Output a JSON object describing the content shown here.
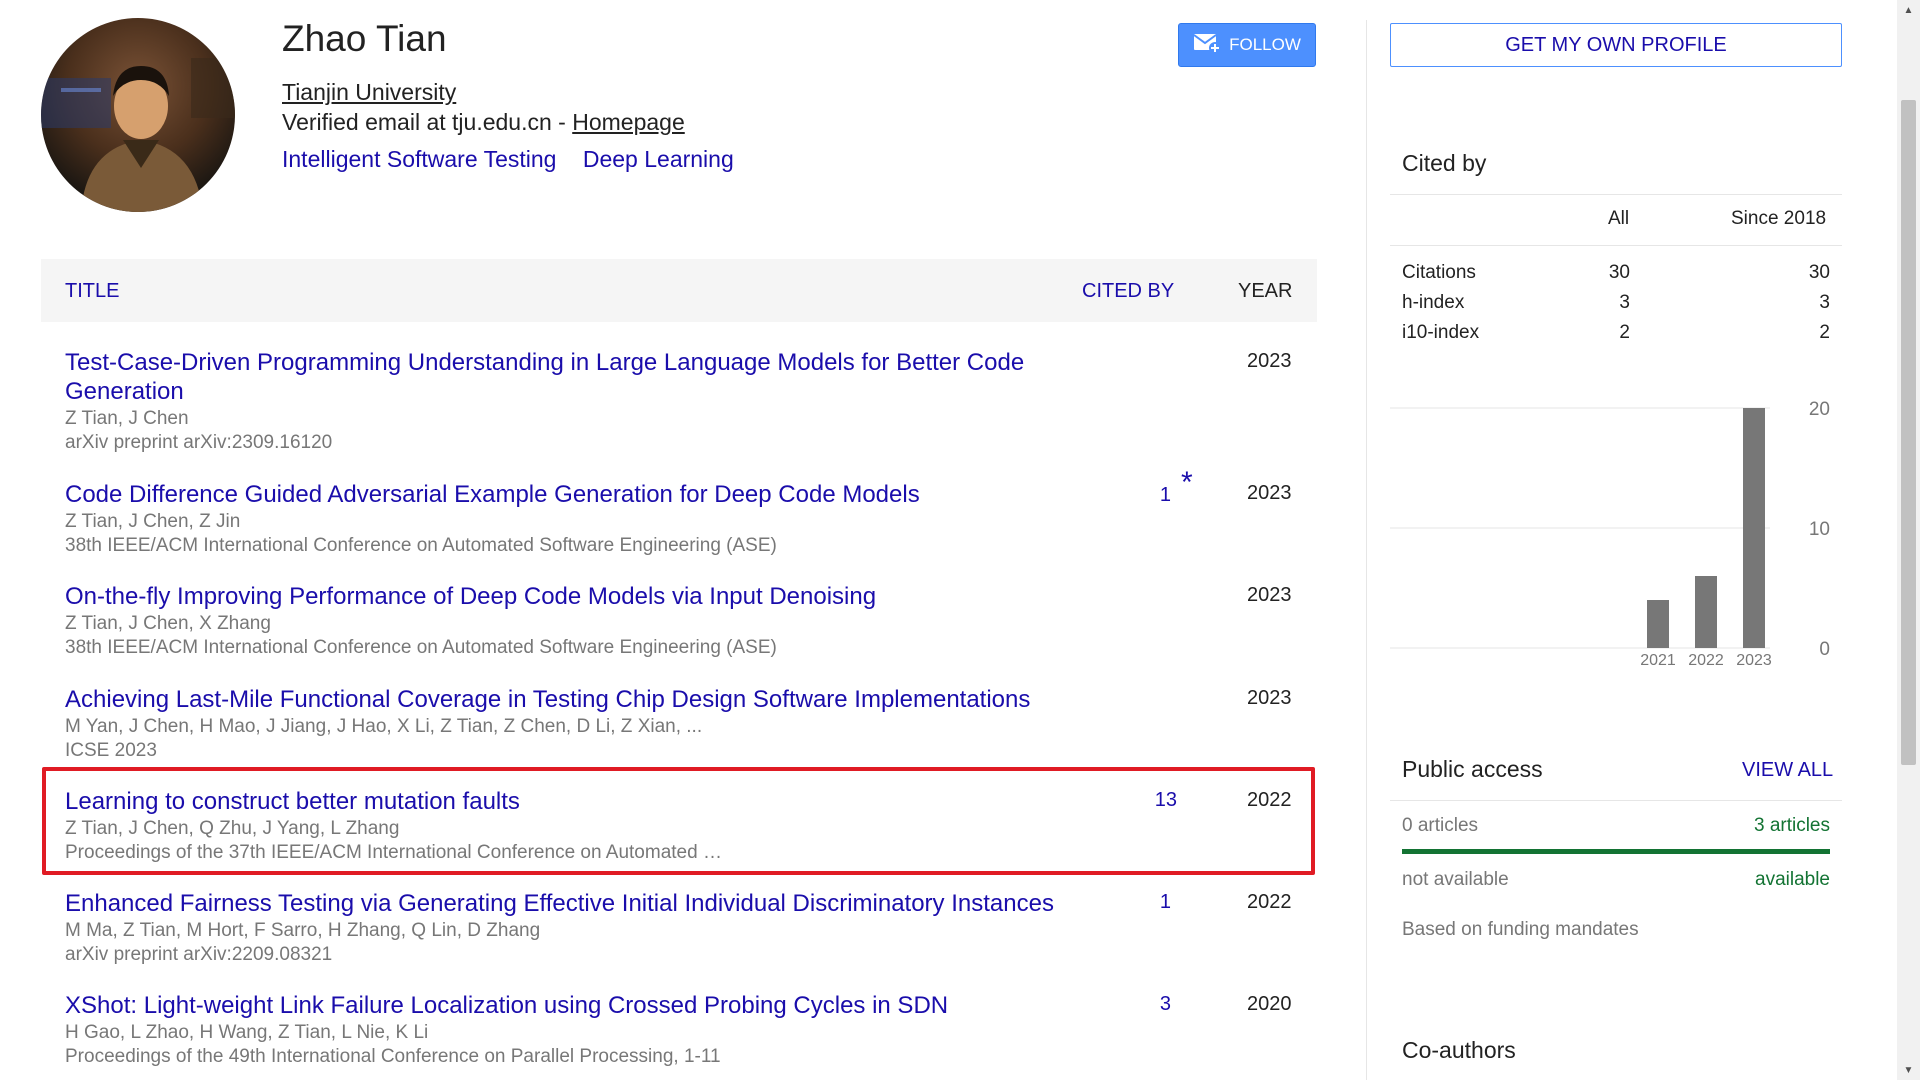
{
  "profile": {
    "name": "Zhao Tian",
    "affiliation": "Tianjin University",
    "email_text": "Verified email at tju.edu.cn - ",
    "homepage_label": "Homepage",
    "interests": [
      "Intelligent Software Testing",
      "Deep Learning"
    ],
    "follow_label": "FOLLOW"
  },
  "table": {
    "col_title": "TITLE",
    "col_cited": "CITED BY",
    "col_year": "YEAR",
    "rows": [
      {
        "title": "Test-Case-Driven Programming Understanding in Large Language Models for Better Code Generation",
        "authors": "Z Tian, J Chen",
        "venue": "arXiv preprint arXiv:2309.16120",
        "cited": "",
        "year": "2023"
      },
      {
        "title": "Code Difference Guided Adversarial Example Generation for Deep Code Models",
        "authors": "Z Tian, J Chen, Z Jin",
        "venue": "38th IEEE/ACM International Conference on Automated Software Engineering (ASE)",
        "cited": "1",
        "star": "*",
        "year": "2023"
      },
      {
        "title": "On-the-fly Improving Performance of Deep Code Models via Input Denoising",
        "authors": "Z Tian, J Chen, X Zhang",
        "venue": "38th IEEE/ACM International Conference on Automated Software Engineering (ASE)",
        "cited": "",
        "year": "2023"
      },
      {
        "title": "Achieving Last-Mile Functional Coverage in Testing Chip Design Software Implementations",
        "authors": "M Yan, J Chen, H Mao, J Jiang, J Hao, X Li, Z Tian, Z Chen, D Li, Z Xian, ...",
        "venue": "ICSE 2023",
        "cited": "",
        "year": "2023"
      },
      {
        "title": "Learning to construct better mutation faults",
        "authors": "Z Tian, J Chen, Q Zhu, J Yang, L Zhang",
        "venue": "Proceedings of the 37th IEEE/ACM International Conference on Automated …",
        "cited": "13",
        "year": "2022"
      },
      {
        "title": "Enhanced Fairness Testing via Generating Effective Initial Individual Discriminatory Instances",
        "authors": "M Ma, Z Tian, M Hort, F Sarro, H Zhang, Q Lin, D Zhang",
        "venue": "arXiv preprint arXiv:2209.08321",
        "cited": "1",
        "year": "2022"
      },
      {
        "title": "XShot: Light-weight Link Failure Localization using Crossed Probing Cycles in SDN",
        "authors": "H Gao, L Zhao, H Wang, Z Tian, L Nie, K Li",
        "venue": "Proceedings of the 49th International Conference on Parallel Processing, 1-11",
        "cited": "3",
        "year": "2020"
      }
    ]
  },
  "sidebar": {
    "own_profile_label": "GET MY OWN PROFILE",
    "cited_by": {
      "heading": "Cited by",
      "col_all": "All",
      "col_since": "Since 2018",
      "rows": [
        {
          "label": "Citations",
          "all": "30",
          "since": "30"
        },
        {
          "label": "h-index",
          "all": "3",
          "since": "3"
        },
        {
          "label": "i10-index",
          "all": "2",
          "since": "2"
        }
      ]
    },
    "public_access": {
      "heading": "Public access",
      "view_all": "VIEW ALL",
      "left_count": "0 articles",
      "right_count": "3 articles",
      "left_status": "not available",
      "right_status": "available",
      "note": "Based on funding mandates"
    },
    "coauthors_heading": "Co-authors"
  },
  "chart_data": {
    "type": "bar",
    "categories": [
      "2021",
      "2022",
      "2023"
    ],
    "values": [
      4,
      6,
      20
    ],
    "y_ticks": [
      0,
      10,
      20
    ],
    "ylim": [
      0,
      20
    ],
    "bar_color": "#777777"
  },
  "colors": {
    "link": "#1a0dab",
    "follow_bg": "#4d90fe",
    "highlight": "#e01b24",
    "available": "#137333"
  }
}
